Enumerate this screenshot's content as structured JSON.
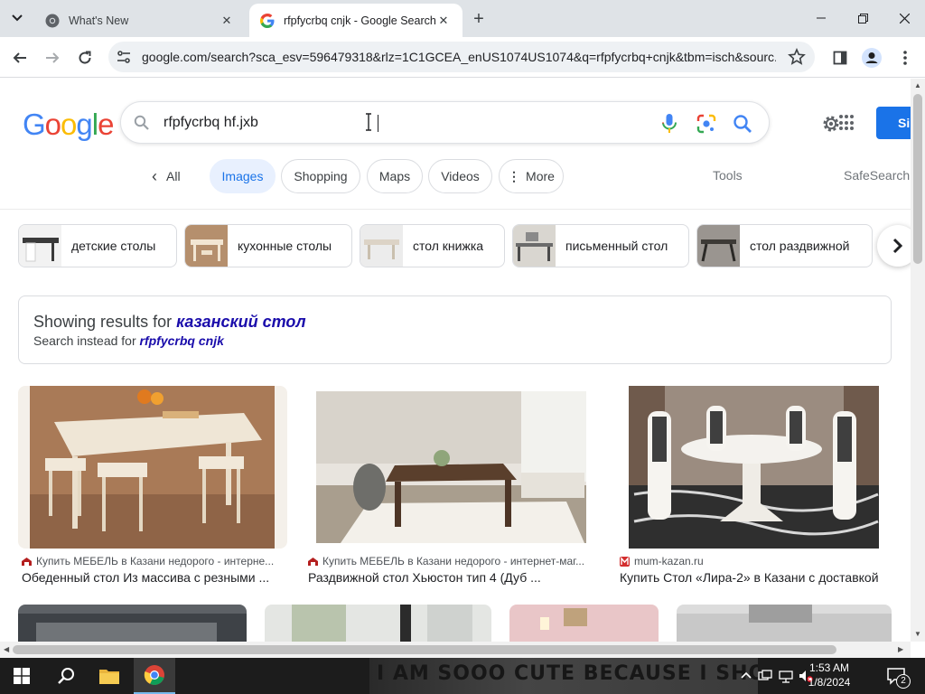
{
  "browser": {
    "tabs": [
      {
        "title": "What's New",
        "close": "✕"
      },
      {
        "title": "rfpfycrbq cnjk - Google Search",
        "close": "✕"
      }
    ],
    "new_tab": "+",
    "url": "google.com/search?sca_esv=596479318&rlz=1C1GCEA_enUS1074US1074&q=rfpfycrbq+cnjk&tbm=isch&sourc..."
  },
  "google": {
    "logo_letters": [
      {
        "ch": "G",
        "color": "#4285F4"
      },
      {
        "ch": "o",
        "color": "#EA4335"
      },
      {
        "ch": "o",
        "color": "#FBBC05"
      },
      {
        "ch": "g",
        "color": "#4285F4"
      },
      {
        "ch": "l",
        "color": "#34A853"
      },
      {
        "ch": "e",
        "color": "#EA4335"
      }
    ],
    "search_value": "rfpfycrbq hf.jxb",
    "signin_label": "Si",
    "nav": {
      "all": "All",
      "images": "Images",
      "shopping": "Shopping",
      "maps": "Maps",
      "videos": "Videos",
      "more": "More",
      "tools": "Tools",
      "safesearch": "SafeSearch"
    },
    "related": [
      {
        "label": "детские столы"
      },
      {
        "label": "кухонные столы"
      },
      {
        "label": "стол книжка"
      },
      {
        "label": "письменный стол"
      },
      {
        "label": "стол раздвижной"
      }
    ],
    "spelling": {
      "showing_prefix": "Showing results for",
      "corrected": "казанский стол",
      "instead_prefix": "Search instead for",
      "original": "rfpfycrbq cnjk"
    },
    "results": [
      {
        "source": "Купить МЕБЕЛЬ в Казани недорого - интерне...",
        "title": "Обеденный стол Из массива с резными ..."
      },
      {
        "source": "Купить МЕБЕЛЬ в Казани недорого - интернет-маг...",
        "title": "Раздвижной стол Хьюстон тип 4 (Дуб ..."
      },
      {
        "source": "mum-kazan.ru",
        "title": "Купить Стол «Лира-2» в Казани с доставкой"
      }
    ]
  },
  "taskbar": {
    "wallpaper_text": "I AM SOOO CUTE BECAUSE I SHOW",
    "time": "1:53 AM",
    "date": "1/8/2024",
    "notification_count": "2"
  },
  "colors": {
    "accent": "#1a73e8",
    "link": "#1a0dab",
    "tabstrip": "#dfe3e7"
  }
}
